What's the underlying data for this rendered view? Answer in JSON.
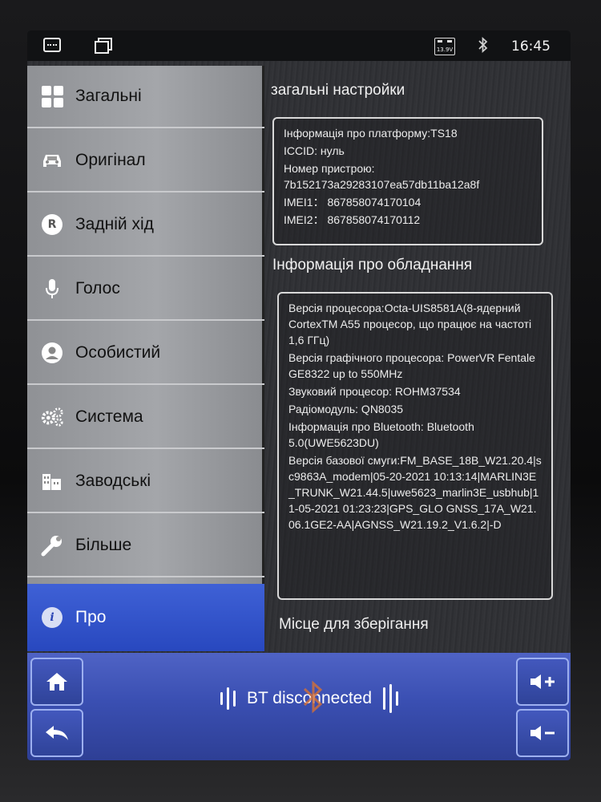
{
  "statusbar": {
    "battery": "13.9V",
    "bluetooth_icon": "bluetooth-icon",
    "time": "16:45"
  },
  "sidebar": {
    "items": [
      {
        "label": "Загальні",
        "icon": "grid-icon"
      },
      {
        "label": "Оригінал",
        "icon": "car-icon"
      },
      {
        "label": "Задній хід",
        "icon": "reverse-icon"
      },
      {
        "label": "Голос",
        "icon": "microphone-icon"
      },
      {
        "label": "Особистий",
        "icon": "user-icon"
      },
      {
        "label": "Система",
        "icon": "gears-icon"
      },
      {
        "label": "Заводські",
        "icon": "factory-icon"
      },
      {
        "label": "Більше",
        "icon": "wrench-icon"
      },
      {
        "label": "Про",
        "icon": "info-icon",
        "active": true
      }
    ]
  },
  "main": {
    "general_title": "загальні настройки",
    "general": [
      "Інформація про платформу:TS18",
      "ICCID: нуль",
      "Номер пристрою:",
      "7b152173a29283107ea57db11ba12a8f",
      "IMEI1： 867858074170104",
      "IMEI2： 867858074170112"
    ],
    "hardware_title": "Інформація про обладнання",
    "hardware": [
      "Версія процесора:Octa-UIS8581A(8-ядерний CortexTM A55 процесор, що працює на частоті 1,6 ГГц)",
      "Версія графічного процесора: PowerVR Fentale GE8322 up to 550MHz",
      "Звуковий процесор: ROHM37534",
      "Радіомодуль: QN8035",
      "Інформація про Bluetooth: Bluetooth 5.0(UWE5623DU)",
      "Версія базової смуги:FM_BASE_18B_W21.20.4|sc9863A_modem|05-20-2021 10:13:14|MARLIN3E_TRUNK_W21.44.5|uwe5623_marlin3E_usbhub|11-05-2021 01:23:23|GPS_GLO GNSS_17A_W21.06.1GE2-AA|AGNSS_W21.19.2_V1.6.2|-D"
    ],
    "storage_title": "Місце для зберігання"
  },
  "bottombar": {
    "bt_status": "BT disconnected"
  },
  "colors": {
    "active_tab": "#2f4fc8",
    "bottom_bar": "#3a4fb2",
    "sidebar": "#9a9c a0"
  }
}
